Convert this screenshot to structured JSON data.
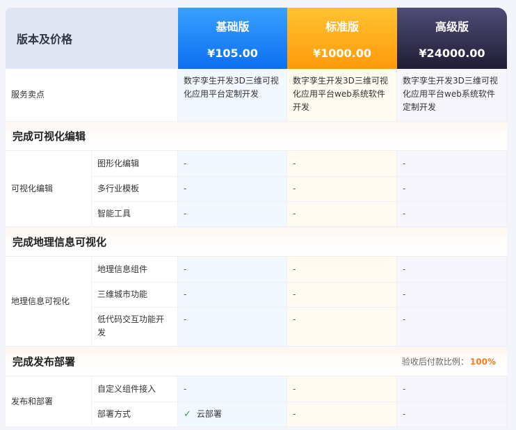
{
  "header": {
    "title": "版本及价格",
    "plans": [
      {
        "name": "基础版",
        "price": "¥105.00"
      },
      {
        "name": "标准版",
        "price": "¥1000.00"
      },
      {
        "name": "高级版",
        "price": "¥24000.00"
      }
    ]
  },
  "service": {
    "label": "服务卖点",
    "basic": "数字孪生开发3D三维可视化应用平台定制开发",
    "std": "数字孪生开发3D三维可视化应用平台web系统软件开发",
    "adv": "数字孪生开发3D三维可视化应用平台web系统软件定制开发"
  },
  "sections": [
    {
      "title": "完成可视化编辑",
      "group": "可视化编辑",
      "rows": [
        {
          "feature": "图形化编辑",
          "basic": "-",
          "std": "-",
          "adv": "-"
        },
        {
          "feature": "多行业模板",
          "basic": "-",
          "std": "-",
          "adv": "-"
        },
        {
          "feature": "智能工具",
          "basic": "-",
          "std": "-",
          "adv": "-"
        }
      ]
    },
    {
      "title": "完成地理信息可视化",
      "group": "地理信息可视化",
      "rows": [
        {
          "feature": "地理信息组件",
          "basic": "-",
          "std": "-",
          "adv": "-"
        },
        {
          "feature": "三维城市功能",
          "basic": "-",
          "std": "-",
          "adv": "-"
        },
        {
          "feature": "低代码交互功能开发",
          "basic": "-",
          "std": "-",
          "adv": "-"
        }
      ]
    },
    {
      "title": "完成发布部署",
      "note_label": "验收后付款比例：",
      "note_value": "100%",
      "group": "发布和部署",
      "rows": [
        {
          "feature": "自定义组件接入",
          "basic": "-",
          "std": "-",
          "adv": "-"
        },
        {
          "feature": "部署方式",
          "basic": "云部署",
          "std": "-",
          "adv": "-"
        }
      ]
    }
  ],
  "colors": {
    "basic": "#0b6ff0",
    "standard": "#ff9a0a",
    "advanced": "#1f1d33",
    "accent": "#ff7a1a",
    "check": "#1aa35c"
  },
  "icons": {
    "deploy_check": "check-icon"
  }
}
